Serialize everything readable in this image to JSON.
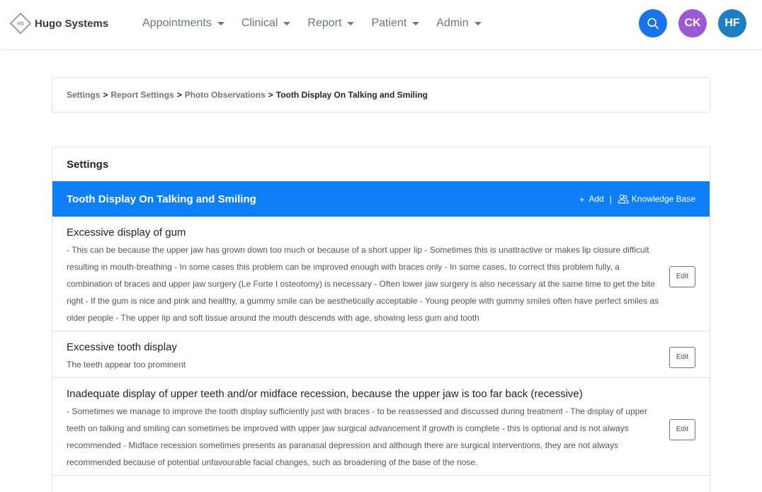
{
  "brand": {
    "logo_text": "HS",
    "name": "Hugo Systems"
  },
  "nav": {
    "items": [
      {
        "label": "Appointments"
      },
      {
        "label": "Clinical"
      },
      {
        "label": "Report"
      },
      {
        "label": "Patient"
      },
      {
        "label": "Admin"
      }
    ],
    "avatars": {
      "user1": "CK",
      "user2": "HF"
    }
  },
  "breadcrumb": {
    "items": [
      "Settings",
      "Report Settings",
      "Photo Observations"
    ],
    "separator": ">",
    "current": "Tooth Display On Talking and Smiling"
  },
  "settings": {
    "title": "Settings",
    "section_title": "Tooth Display On Talking and Smiling",
    "add_label": "Add",
    "separator": "|",
    "knowledge_base_label": "Knowledge Base",
    "edit_label": "Edit",
    "items": [
      {
        "title": "Excessive display of gum",
        "description": "- This can be because the upper jaw has grown down too much or because of a short upper lip - Sometimes this is unattractive or makes lip closure difficult resulting in mouth-breathing - In some cases this problem can be improved enough with braces only - In some cases, to correct this problem fully, a combination of braces and upper jaw surgery (Le Forte I osteotomy) is necessary - Often lower jaw surgery is also necessary at the same time to get the bite right - If the gum is nice and pink and healthy, a gummy smile can be aesthetically acceptable - Young people with gummy smiles often have perfect smiles as older people - The upper lip and soft tissue around the mouth descends with age, showing less gum and tooth"
      },
      {
        "title": "Excessive tooth display",
        "description": "The teeth appear too prominent"
      },
      {
        "title": "Inadequate display of upper teeth and/or midface recession, because the upper jaw is too far back (recessive)",
        "description": "- Sometimes we manage to improve the tooth display sufficiently just with braces - to be reassessed and discussed during treatment - The display of upper teeth on talking and smiling can sometimes be improved with upper jaw surgical advancement if growth is complete - this is optional and is not always recommended - Midface recession sometimes presents as paranasal depression and although there are surgical interventions, they are not always recommended because of potential unfavourable facial changes, such as broadening of the base of the nose."
      }
    ]
  },
  "colors": {
    "primary": "#0d7ff7",
    "avatar_ck": "#9b59d6",
    "avatar_hf": "#1f7fc1",
    "search": "#1a73e8"
  }
}
